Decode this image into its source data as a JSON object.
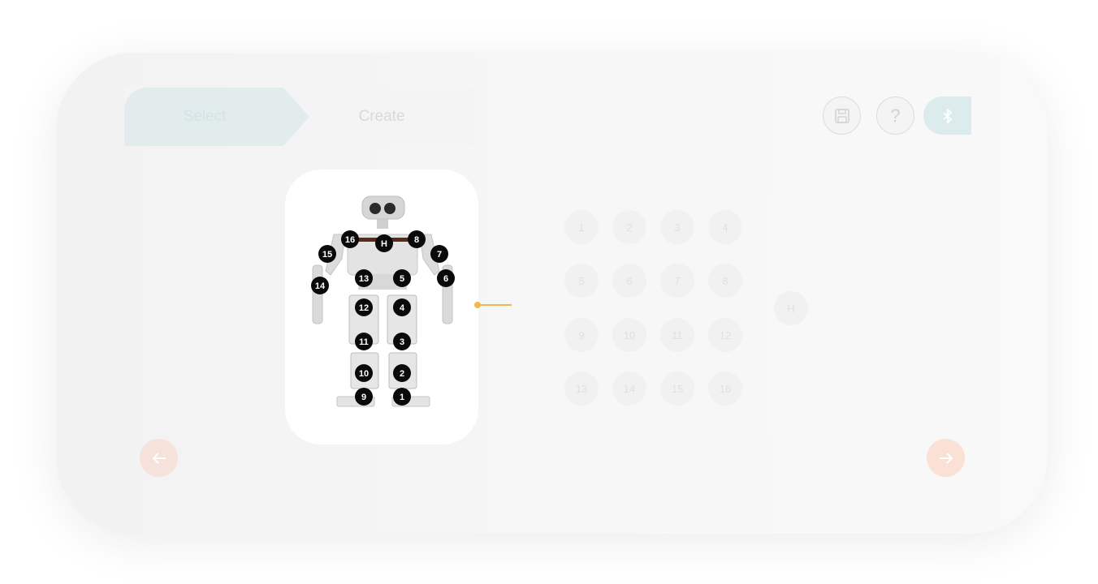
{
  "tabs": [
    {
      "label": "Select",
      "active": true
    },
    {
      "label": "Create",
      "active": false
    }
  ],
  "header_buttons": {
    "save_icon": "save-icon",
    "help_label": "?",
    "bluetooth_icon": "bluetooth-icon"
  },
  "robot": {
    "head_label": "H",
    "joint_labels": [
      "16",
      "H",
      "8",
      "15",
      "7",
      "14",
      "13",
      "5",
      "6",
      "12",
      "4",
      "11",
      "3",
      "10",
      "2",
      "9",
      "1"
    ]
  },
  "servo_grid": {
    "rows": [
      [
        "1",
        "2",
        "3",
        "4"
      ],
      [
        "5",
        "6",
        "7",
        "8"
      ],
      [
        "9",
        "10",
        "11",
        "12"
      ],
      [
        "13",
        "14",
        "15",
        "16"
      ]
    ],
    "head_button": "H"
  },
  "navigation": {
    "prev_icon": "arrow-left-icon",
    "next_icon": "arrow-right-icon"
  },
  "colors": {
    "accent": "#f2b84b",
    "select_tab": "#e2eced",
    "joint_marker": "#0a0a0a"
  }
}
